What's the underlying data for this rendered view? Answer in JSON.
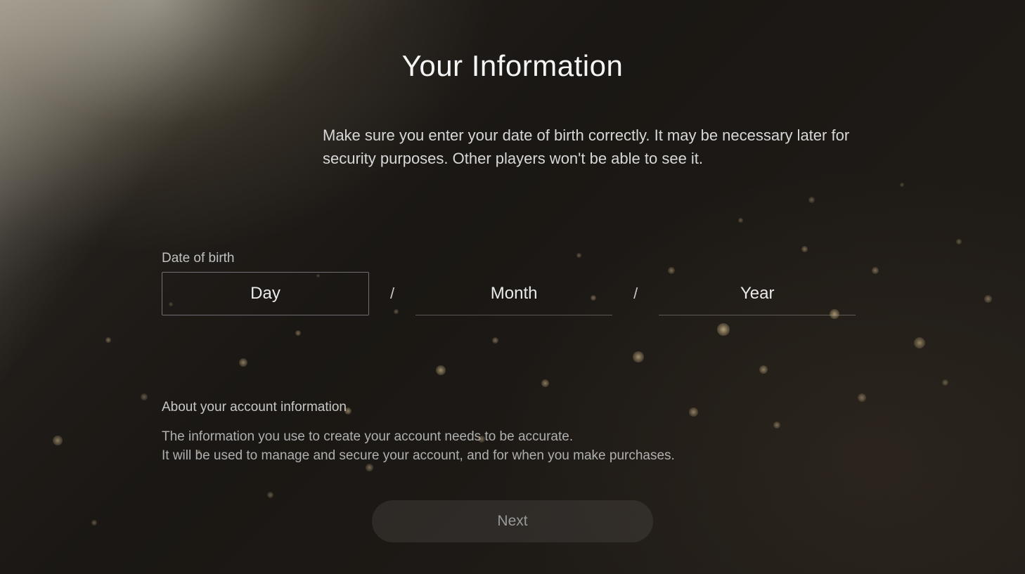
{
  "title": "Your Information",
  "description": "Make sure you enter your date of birth correctly. It may be necessary later for security purposes. Other players won't be able to see it.",
  "dob": {
    "label": "Date of birth",
    "day_placeholder": "Day",
    "month_placeholder": "Month",
    "year_placeholder": "Year",
    "separator": "/"
  },
  "info": {
    "heading": "About your account information",
    "line1": "The information you use to create your account needs to be accurate.",
    "line2": "It will be used to manage and secure your account, and for when you make purchases."
  },
  "next_button": "Next"
}
